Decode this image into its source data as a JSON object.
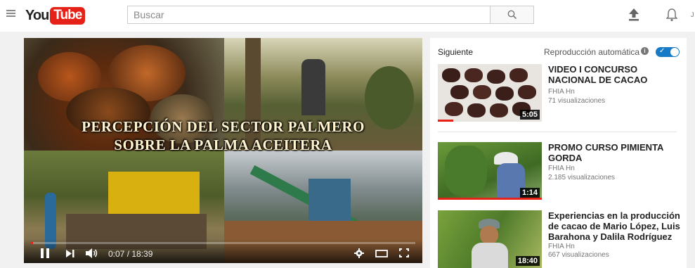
{
  "header": {
    "logo_you": "You",
    "logo_tube": "Tube",
    "search_placeholder": "Buscar",
    "edge_char": "J"
  },
  "icons": {
    "menu": "hamburger-menu-icon",
    "search": "search-icon",
    "upload": "upload-icon",
    "notifications": "bell-icon",
    "play_pause": "pause-icon",
    "next": "next-icon",
    "volume": "volume-icon",
    "settings": "gear-icon",
    "theater": "theater-mode-icon",
    "fullscreen": "fullscreen-icon",
    "info": "info-icon"
  },
  "colors": {
    "brand_red": "#e62117",
    "toggle_blue": "#167ac6"
  },
  "player": {
    "overlay_line1": "PERCEPCIÓN DEL SECTOR PALMERO",
    "overlay_line2": "SOBRE LA PALMA ACEITERA",
    "current_time": "0:07",
    "duration": "18:39",
    "time_display": "0:07 / 18:39",
    "progress": 0.006
  },
  "sidebar": {
    "next_label": "Siguiente",
    "autoplay_label": "Reproducción automática",
    "info_glyph": "i",
    "autoplay_on": true,
    "videos": [
      {
        "title": "VIDEO I CONCURSO NACIONAL DE CACAO",
        "channel": "FHIA Hn",
        "views": "71 visualizaciones",
        "duration": "5:05",
        "watched": 0.15
      },
      {
        "title": "PROMO CURSO PIMIENTA GORDA",
        "channel": "FHIA Hn",
        "views": "2.185 visualizaciones",
        "duration": "1:14",
        "watched": 1.0
      },
      {
        "title": "Experiencias en la producción de cacao de Mario López, Luis Barahona y Dalila Rodríguez",
        "channel": "FHIA Hn",
        "views": "667 visualizaciones",
        "duration": "18:40",
        "watched": 0
      }
    ]
  }
}
